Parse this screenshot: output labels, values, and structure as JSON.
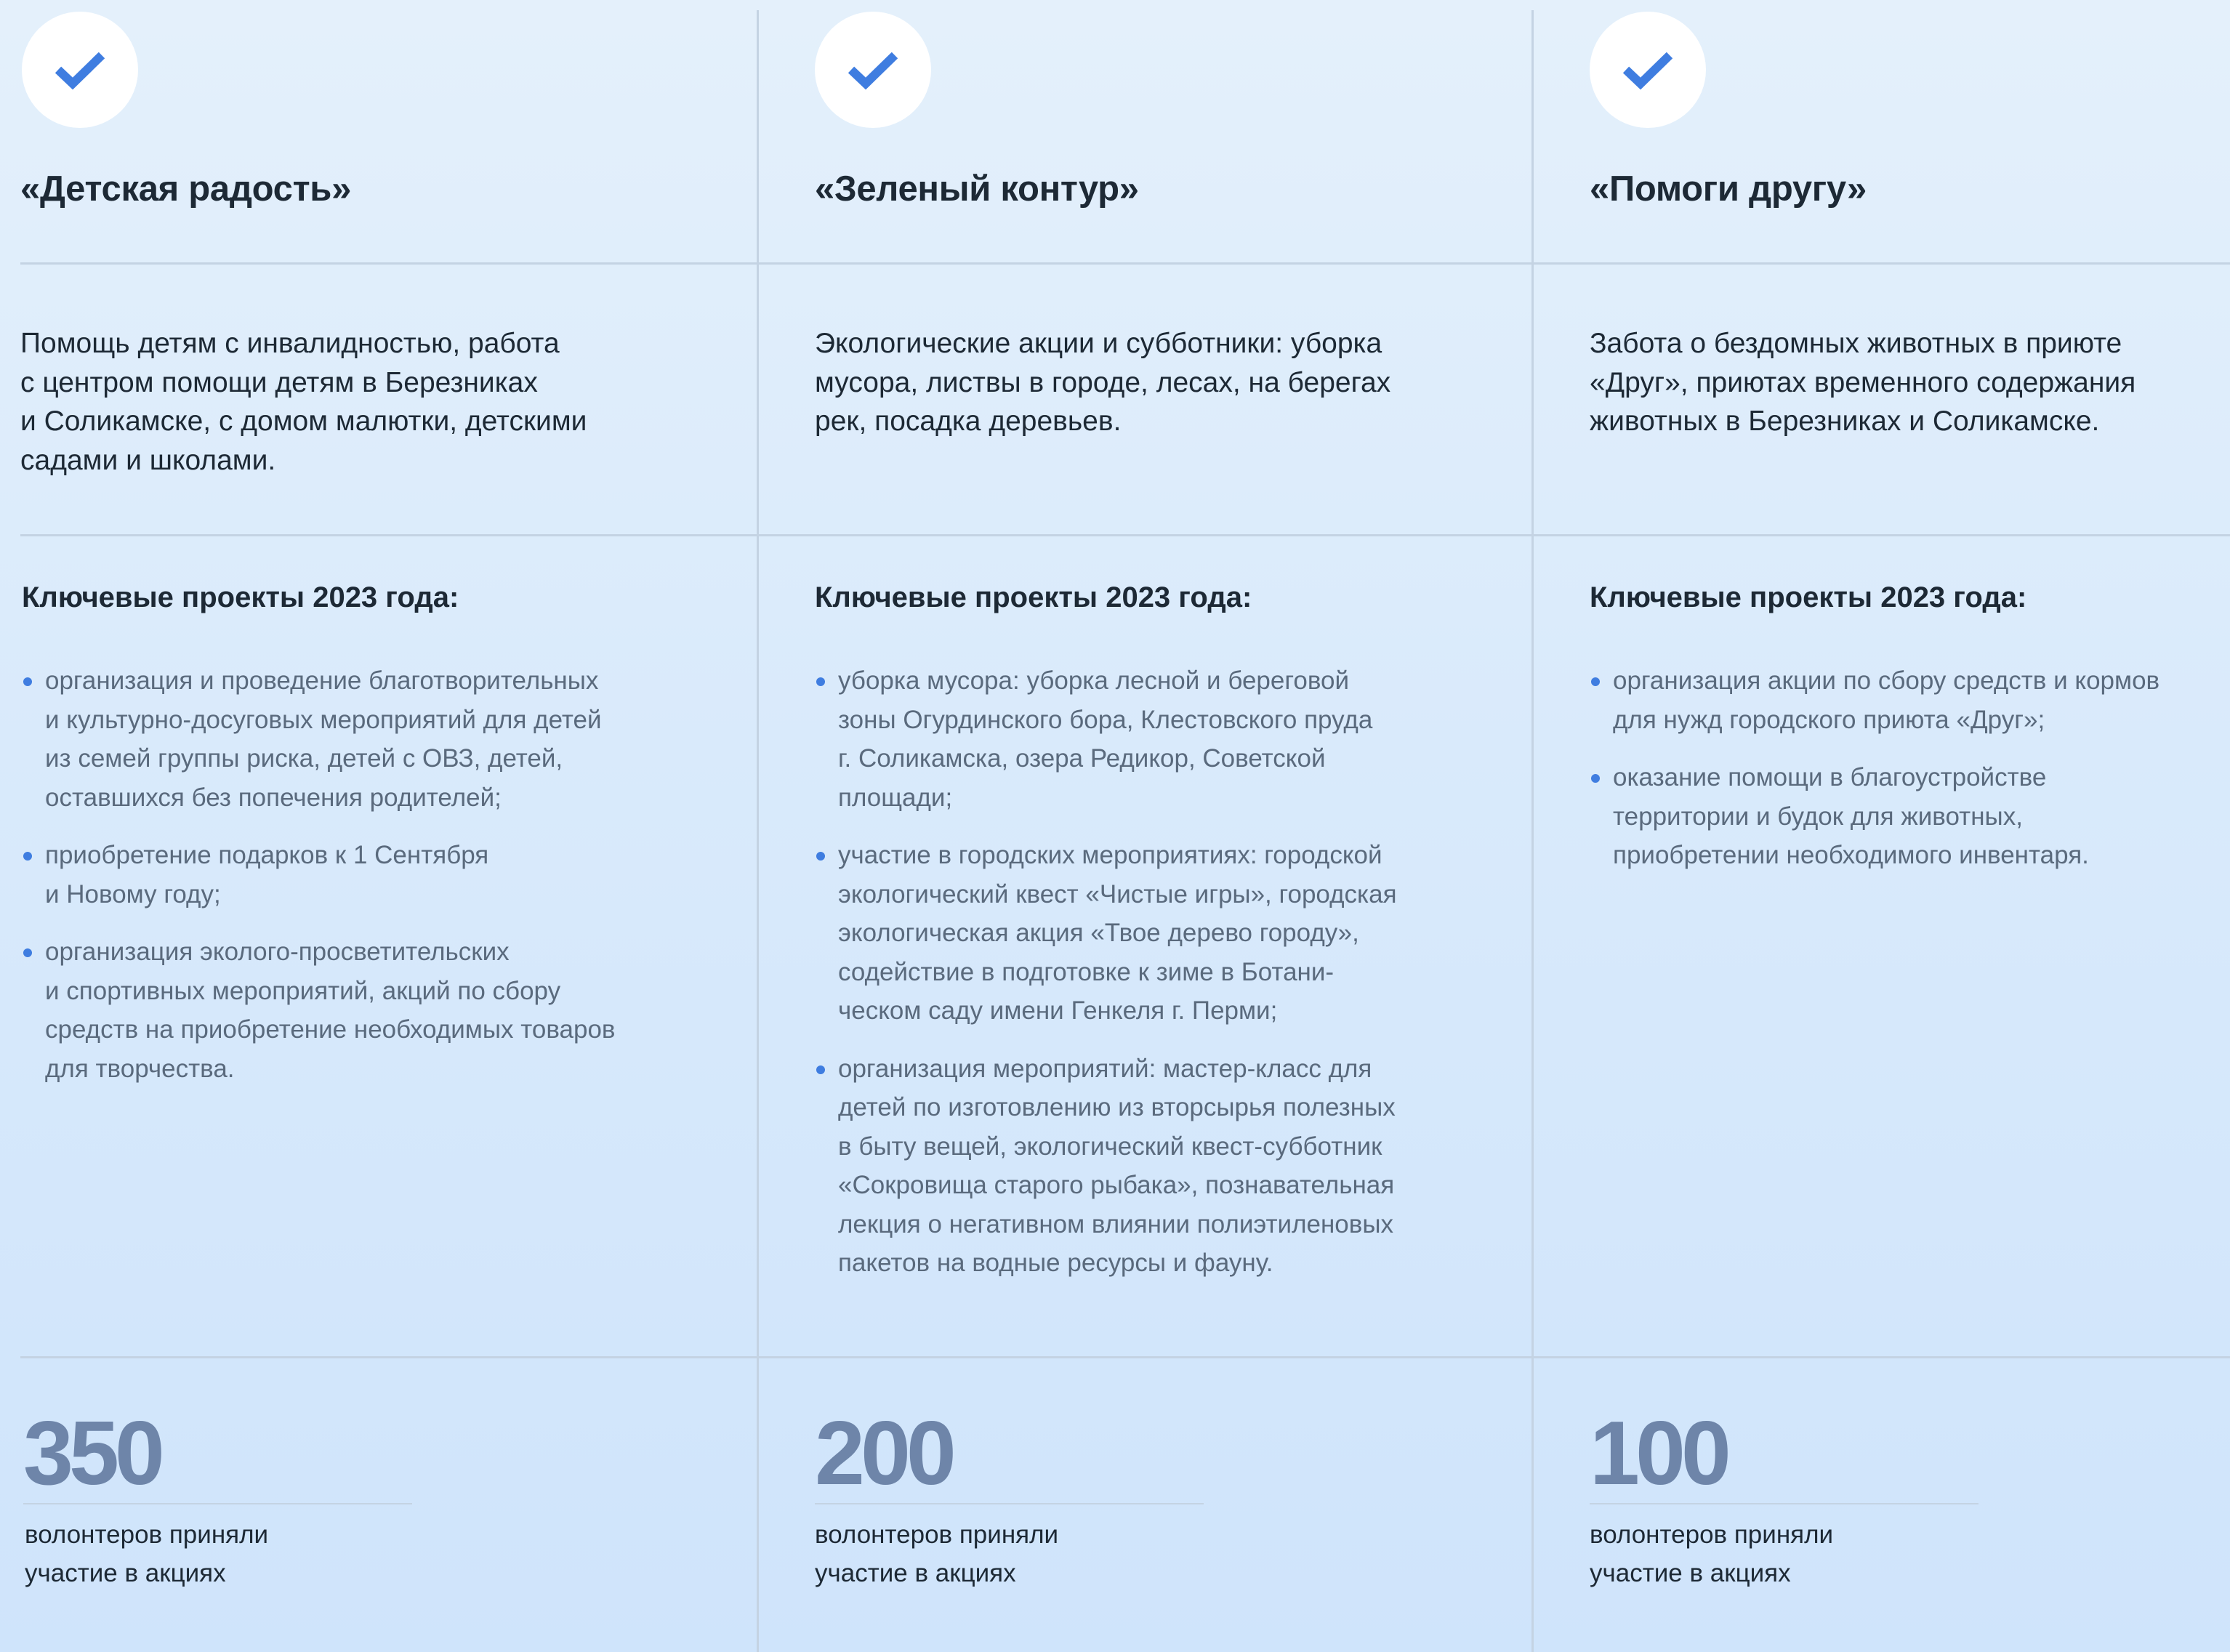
{
  "columns": [
    {
      "title": "«Детская радость»",
      "description": "Помощь детям с инвалидностью, работа\nс центром помощи детям в Березниках\nи Соликамске, с домом малютки, детскими\nсадами и школами.",
      "projects_heading": "Ключевые проекты 2023 года:",
      "projects": [
        "организация и проведение благотворительных\nи культурно-досуговых мероприятий для детей\nиз семей группы риска, детей с ОВЗ, детей,\nоставшихся без попечения родителей;",
        "приобретение подарков к 1 Сентября\nи Новому году;",
        "организация эколого-просветительских\nи спортивных мероприятий, акций по сбору\nсредств на приобретение необходимых товаров\nдля творчества."
      ],
      "stat_value": "350",
      "stat_label": "волонтеров приняли\nучастие в акциях"
    },
    {
      "title": "«Зеленый контур»",
      "description": "Экологические акции и субботники: уборка\nмусора, листвы в городе, лесах, на берегах\nрек, посадка деревьев.",
      "projects_heading": "Ключевые проекты 2023 года:",
      "projects": [
        "уборка мусора: уборка лесной и береговой\nзоны Огурдинского бора, Клестовского пруда\nг. Соликамска, озера Редикор, Советской\nплощади;",
        "участие в городских мероприятиях: городской\nэкологический квест «Чистые игры», городская\nэкологическая акция «Твое дерево городу»,\nсодействие в подготовке к зиме в Ботани-\nческом саду имени Генкеля г. Перми;",
        "организация мероприятий: мастер-класс для\nдетей по изготовлению из вторсырья полезных\nв быту вещей, экологический квест-субботник\n«Сокровища старого рыбака», познавательная\nлекция о негативном влиянии полиэтиленовых\nпакетов на водные ресурсы и фауну."
      ],
      "stat_value": "200",
      "stat_label": "волонтеров приняли\nучастие в акциях"
    },
    {
      "title": "«Помоги другу»",
      "description": "Забота о бездомных животных в приюте\n«Друг», приютах временного содержания\nживотных в Березниках и Соликамске.",
      "projects_heading": "Ключевые проекты 2023 года:",
      "projects": [
        "организация акции по сбору средств и кормов\nдля нужд городского приюта «Друг»;",
        "оказание помощи в благоустройстве\nтерритории и будок для животных,\nприобретении необходимого инвентаря."
      ],
      "stat_value": "100",
      "stat_label": "волонтеров приняли\nучастие в акциях"
    }
  ],
  "icons": {
    "check": "checkmark-icon"
  },
  "colors": {
    "accent": "#3f7de0",
    "stat_number": "#6e85a9",
    "divider": "#c4d3e3"
  }
}
